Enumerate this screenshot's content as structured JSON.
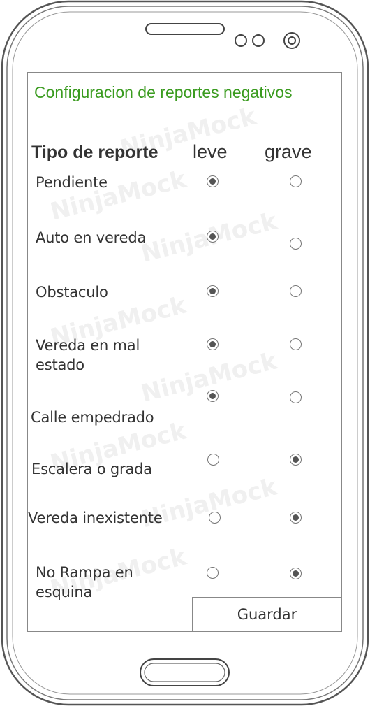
{
  "app": {
    "title": "Configuracion de reportes negativos",
    "watermark": "NinjaMock"
  },
  "table": {
    "headers": {
      "type": "Tipo de reporte",
      "leve": "leve",
      "grave": "grave"
    },
    "rows": [
      {
        "label": "Pendiente",
        "lines": [
          "Pendiente"
        ],
        "selected": "leve"
      },
      {
        "label": "Auto en vereda",
        "lines": [
          "Auto en vereda"
        ],
        "selected": "leve"
      },
      {
        "label": "Obstaculo",
        "lines": [
          "Obstaculo"
        ],
        "selected": "leve"
      },
      {
        "label": "Vereda en mal estado",
        "lines": [
          "Vereda en mal",
          "estado"
        ],
        "selected": "leve"
      },
      {
        "label": "Calle empedrado",
        "lines": [
          "Calle empedrado"
        ],
        "selected": "leve"
      },
      {
        "label": "Escalera o grada",
        "lines": [
          "Escalera o grada"
        ],
        "selected": "grave"
      },
      {
        "label": "Vereda inexistente",
        "lines": [
          "Vereda inexistente"
        ],
        "selected": "grave"
      },
      {
        "label": "No Rampa en esquina",
        "lines": [
          "No Rampa en",
          "esquina"
        ],
        "selected": "grave"
      }
    ]
  },
  "footer": {
    "save_label": "Guardar"
  },
  "colors": {
    "title": "#3a9b1f",
    "frame": "#888888",
    "radio_dot": "#555555"
  },
  "icons": [
    "speaker-grille-icon",
    "front-camera-icon",
    "sensor-icon",
    "home-button-icon"
  ]
}
